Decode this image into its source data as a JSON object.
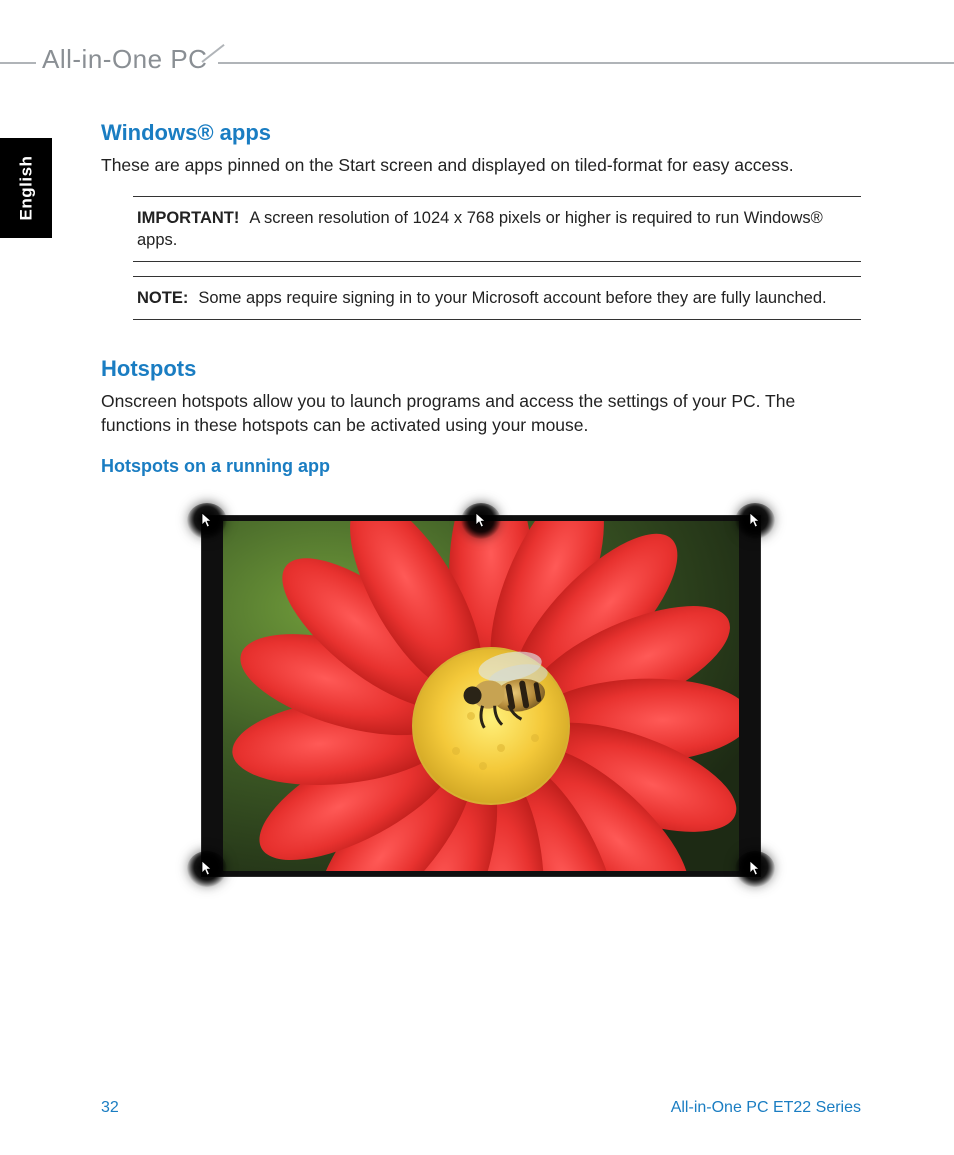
{
  "header": {
    "title": "All-in-One PC"
  },
  "sideTab": {
    "language": "English"
  },
  "sections": {
    "winapps": {
      "heading": "Windows® apps",
      "intro": "These are apps pinned on the Start screen and displayed on tiled-format for easy access.",
      "importantLabel": "IMPORTANT!",
      "importantText": "A screen resolution of 1024 x 768 pixels or higher is required to run Windows® apps.",
      "noteLabel": "NOTE:",
      "noteText": "Some apps require signing in to your Microsoft account before they are fully launched."
    },
    "hotspots": {
      "heading": "Hotspots",
      "intro": "Onscreen hotspots allow you to launch programs and access the settings of your PC. The functions in these hotspots can be activated using your mouse.",
      "subheading": "Hotspots on a running app"
    }
  },
  "figure": {
    "hotspotPositions": [
      "top-left",
      "top-center",
      "top-right",
      "bottom-left",
      "bottom-right"
    ]
  },
  "footer": {
    "pageNumber": "32",
    "series": "All-in-One PC ET22 Series"
  }
}
